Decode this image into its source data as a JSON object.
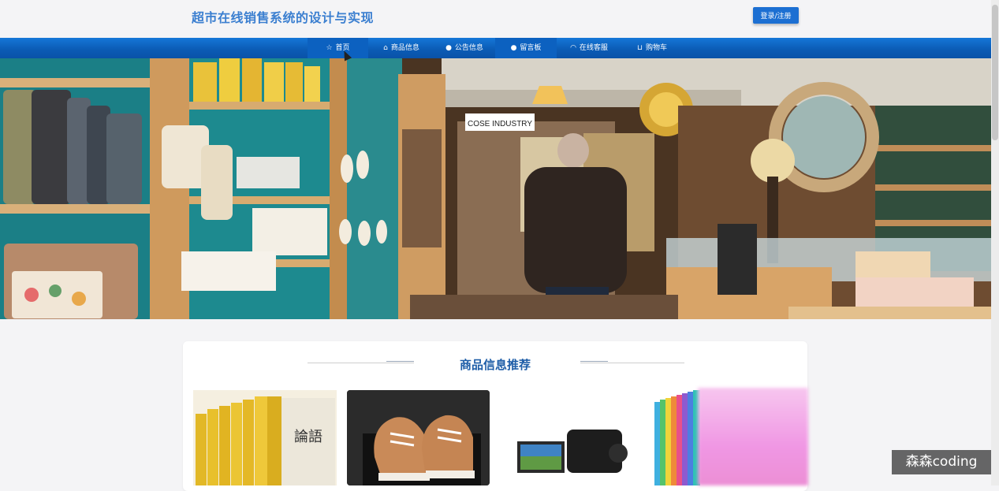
{
  "header": {
    "site_title": "超市在线销售系统的设计与实现",
    "login_label": "登录/注册"
  },
  "nav": {
    "items": [
      {
        "label": "首页",
        "icon": "star-icon"
      },
      {
        "label": "商品信息",
        "icon": "bag-icon"
      },
      {
        "label": "公告信息",
        "icon": "info-icon"
      },
      {
        "label": "留言板",
        "icon": "message-icon"
      },
      {
        "label": "在线客服",
        "icon": "headset-icon"
      },
      {
        "label": "购物车",
        "icon": "cart-icon"
      }
    ],
    "active_index": 0
  },
  "banner": {
    "store_sign": "COSE INDUSTRY",
    "slide_count": 3,
    "active_slide": 0
  },
  "section": {
    "title": "商品信息推荐"
  },
  "products": [
    {
      "name": "book-set",
      "cover_text": "論語"
    },
    {
      "name": "sneakers"
    },
    {
      "name": "camcorder"
    },
    {
      "name": "color-books"
    }
  ],
  "watermark": "森森coding",
  "colors": {
    "accent": "#1c6fd2",
    "nav": "#0b5cb6",
    "title": "#1f5ea8"
  }
}
